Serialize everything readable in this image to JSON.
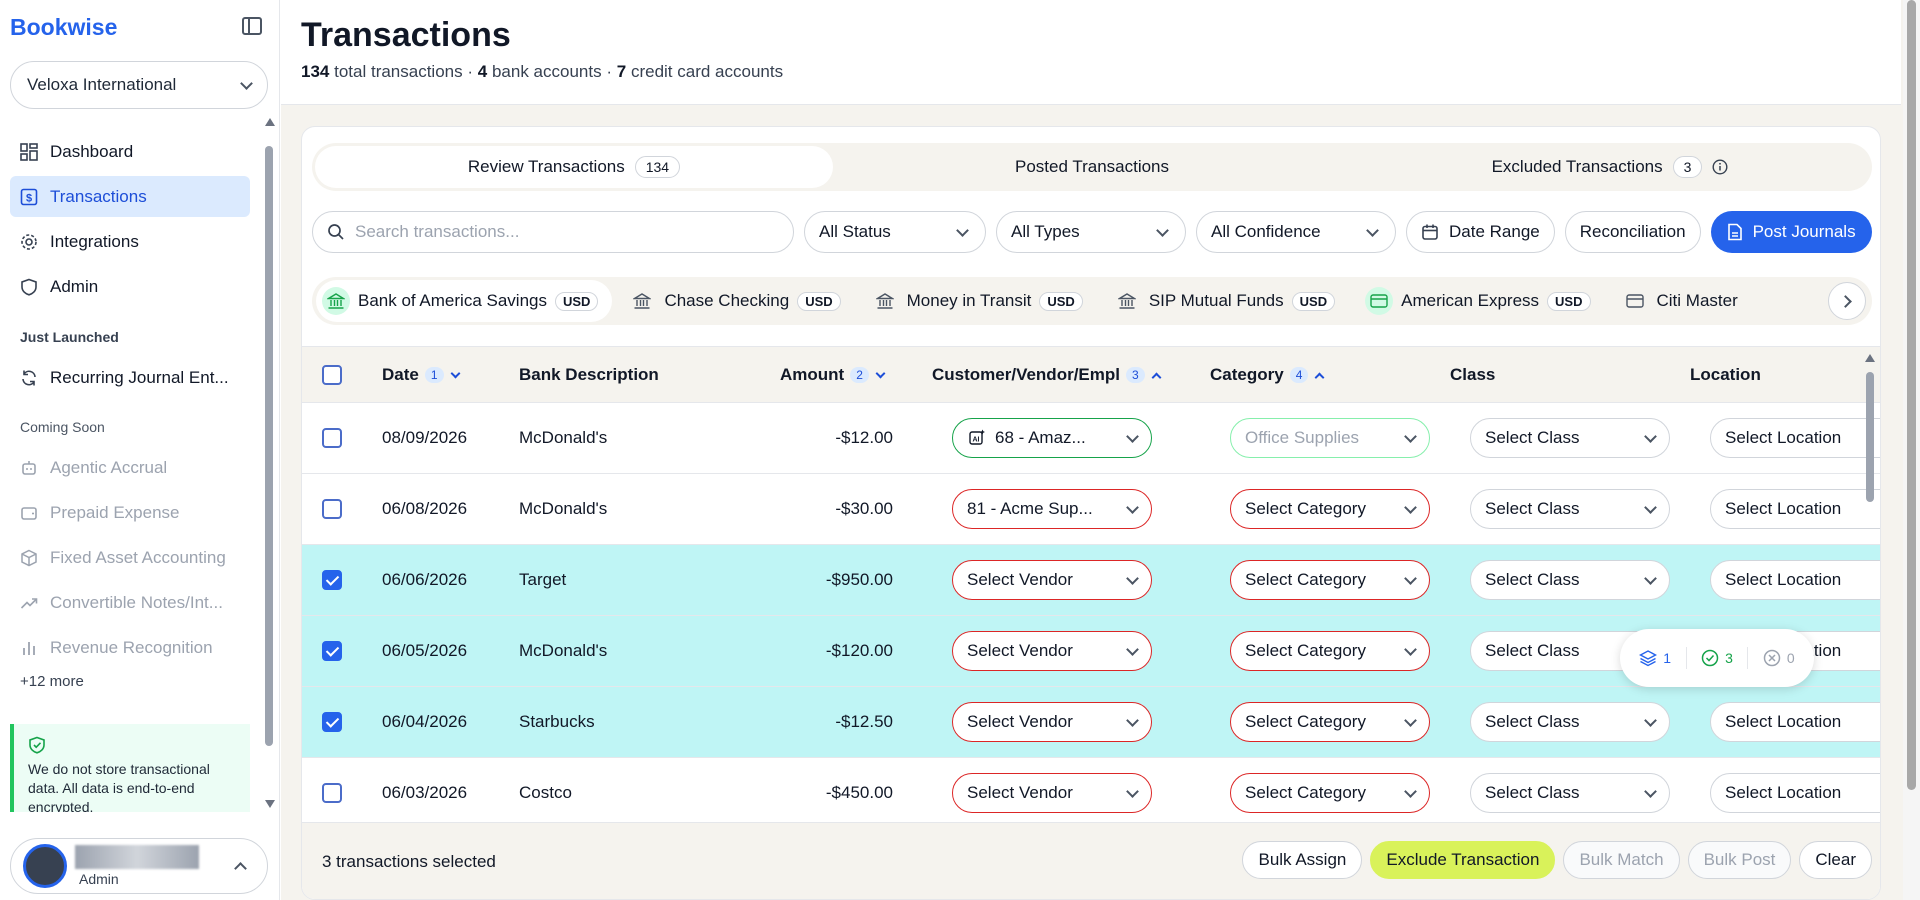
{
  "app": {
    "brand": "Bookwise"
  },
  "org": {
    "name": "Veloxa International"
  },
  "sidebar": {
    "items": [
      {
        "label": "Dashboard",
        "icon": "dashboard-icon"
      },
      {
        "label": "Transactions",
        "icon": "dollar-icon",
        "active": true
      },
      {
        "label": "Integrations",
        "icon": "gear-icon"
      },
      {
        "label": "Admin",
        "icon": "shield-icon"
      }
    ],
    "just_launched_title": "Just Launched",
    "just_launched": [
      {
        "label": "Recurring Journal Ent...",
        "icon": "refresh-icon"
      }
    ],
    "coming_soon_title": "Coming Soon",
    "coming_soon": [
      {
        "label": "Agentic Accrual",
        "icon": "robot-icon"
      },
      {
        "label": "Prepaid Expense",
        "icon": "wallet-icon"
      },
      {
        "label": "Fixed Asset Accounting",
        "icon": "cube-icon"
      },
      {
        "label": "Convertible Notes/Int...",
        "icon": "trend-icon"
      },
      {
        "label": "Revenue Recognition",
        "icon": "bar-chart-icon"
      }
    ],
    "more": "+12 more",
    "security_note": "We do not store transactional data. All data is end-to-end encrypted.",
    "user_role": "Admin"
  },
  "header": {
    "title": "Transactions",
    "total_count": "134",
    "total_label": "total transactions",
    "bank_count": "4",
    "bank_label": "bank accounts",
    "cc_count": "7",
    "cc_label": "credit card accounts",
    "sep": "·"
  },
  "tabs": [
    {
      "label": "Review Transactions",
      "count": "134",
      "active": true
    },
    {
      "label": "Posted Transactions"
    },
    {
      "label": "Excluded Transactions",
      "count": "3"
    }
  ],
  "filters": {
    "search_placeholder": "Search transactions...",
    "status": "All Status",
    "types": "All Types",
    "confidence": "All Confidence",
    "date_range": "Date Range",
    "reconciliation": "Reconciliation",
    "post_journals": "Post Journals"
  },
  "accounts": [
    {
      "name": "Bank of America Savings",
      "currency": "USD",
      "icon": "bank-icon",
      "active": true
    },
    {
      "name": "Chase Checking",
      "currency": "USD",
      "icon": "bank-icon"
    },
    {
      "name": "Money in Transit",
      "currency": "USD",
      "icon": "bank-icon"
    },
    {
      "name": "SIP Mutual Funds",
      "currency": "USD",
      "icon": "bank-icon"
    },
    {
      "name": "American Express",
      "currency": "USD",
      "icon": "credit-card-icon"
    },
    {
      "name": "Citi Master",
      "icon": "credit-card-icon"
    }
  ],
  "table": {
    "columns": {
      "date": "Date",
      "date_sort": "1",
      "description": "Bank Description",
      "amount": "Amount",
      "amount_sort": "2",
      "customer": "Customer/Vendor/Empl",
      "customer_sort": "3",
      "category": "Category",
      "category_sort": "4",
      "class": "Class",
      "location": "Location"
    },
    "rows": [
      {
        "checked": false,
        "date": "08/09/2026",
        "description": "McDonald's",
        "amount": "-$12.00",
        "vendor": "68 - Amaz...",
        "vendor_state": "ok",
        "vendor_ai": true,
        "category": "Office Supplies",
        "category_state": "ok-muted",
        "class": "Select Class",
        "location": "Select Location"
      },
      {
        "checked": false,
        "date": "06/08/2026",
        "description": "McDonald's",
        "amount": "-$30.00",
        "vendor": "81 - Acme Sup...",
        "vendor_state": "error",
        "vendor_ai": false,
        "category": "Select Category",
        "category_state": "error",
        "class": "Select Class",
        "location": "Select Location"
      },
      {
        "checked": true,
        "date": "06/06/2026",
        "description": "Target",
        "amount": "-$950.00",
        "vendor": "Select Vendor",
        "vendor_state": "error",
        "vendor_ai": false,
        "category": "Select Category",
        "category_state": "error",
        "class": "Select Class",
        "location": "Select Location"
      },
      {
        "checked": true,
        "date": "06/05/2026",
        "description": "McDonald's",
        "amount": "-$120.00",
        "vendor": "Select Vendor",
        "vendor_state": "error",
        "vendor_ai": false,
        "category": "Select Category",
        "category_state": "error",
        "class": "Select Class",
        "location": "Select Location"
      },
      {
        "checked": true,
        "date": "06/04/2026",
        "description": "Starbucks",
        "amount": "-$12.50",
        "vendor": "Select Vendor",
        "vendor_state": "error",
        "vendor_ai": false,
        "category": "Select Category",
        "category_state": "error",
        "class": "Select Class",
        "location": "Select Location"
      },
      {
        "checked": false,
        "date": "06/03/2026",
        "description": "Costco",
        "amount": "-$450.00",
        "vendor": "Select Vendor",
        "vendor_state": "error",
        "vendor_ai": false,
        "category": "Select Category",
        "category_state": "error",
        "class": "Select Class",
        "location": "Select Location"
      }
    ]
  },
  "stats": {
    "layers": "1",
    "approved": "3",
    "rejected": "0"
  },
  "bulk": {
    "selected_text": "3 transactions selected",
    "assign": "Bulk Assign",
    "exclude": "Exclude Transaction",
    "match": "Bulk Match",
    "post": "Bulk Post",
    "clear": "Clear"
  },
  "colors": {
    "accent": "#2563eb",
    "selected_row": "#bff5f5",
    "error": "#dc2626",
    "ok": "#16a34a",
    "lime": "#d9f25a"
  }
}
